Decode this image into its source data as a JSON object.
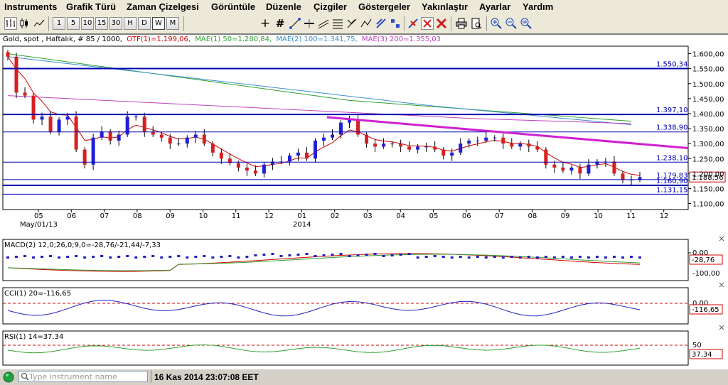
{
  "menu": [
    "Instruments",
    "Grafik Türü",
    "Zaman Çizelgesi",
    "Görüntüle",
    "Düzenle",
    "Çizgiler",
    "Göstergeler",
    "Yakınlaştır",
    "Ayarlar",
    "Yardım"
  ],
  "toolbar": {
    "timeframes": [
      "1",
      "5",
      "10",
      "15",
      "30",
      "H",
      "D",
      "W",
      "M"
    ],
    "active_timeframe": "W",
    "icons": [
      "bar-chart-icon",
      "candle-chart-icon",
      "line-chart-icon",
      "crosshair-icon",
      "grid-hash-icon",
      "draw-line-icon",
      "draw-horizontal-icon",
      "draw-channel-icon",
      "draw-fibo-icon",
      "draw-ray-icon",
      "draw-trend-icon",
      "delete-line-icon",
      "delete-all-icon",
      "print-icon",
      "print-preview-icon",
      "zoom-in-icon",
      "zoom-out-icon",
      "zoom-reset-icon"
    ]
  },
  "chart": {
    "legend": {
      "instrument": "Gold, spot , Haftalık, # 85 / 1000,",
      "otf": "OTF(1)=1.199,06,",
      "mae1": "MAE(1) 50=1.280,84,",
      "mae2": "MAE(2) 100=1.341,75,",
      "mae3": "MAE(3) 200=1.355,03"
    },
    "x_labels": [
      "05",
      "06",
      "07",
      "08",
      "09",
      "10",
      "11",
      "12",
      "01",
      "02",
      "03",
      "04",
      "05",
      "06",
      "07",
      "08",
      "09",
      "10",
      "11",
      "12"
    ],
    "date_label": "May/01/13",
    "year_label": "2014",
    "y_ticks": [
      "1.600,00",
      "1.550,00",
      "1.500,00",
      "1.450,00",
      "1.400,00",
      "1.350,00",
      "1.300,00",
      "1.250,00",
      "1.200,00",
      "1.150,00",
      "1.100,00"
    ],
    "h_lines": [
      "1.550,34",
      "1.397,10",
      "1.338,90",
      "1.238,10",
      "1.179,83",
      "1.160,90",
      "1.131,15"
    ],
    "current_price": "1.188,56",
    "colors": {
      "bull": "#1f1fd8",
      "bear": "#d81f1f",
      "otf": "#d40000",
      "mae1": "#2ea02e",
      "mae2": "#3a8fd0",
      "mae3": "#c040c0",
      "hline": "#0000b0",
      "trend": "#d020d0"
    }
  },
  "chart_data": {
    "type": "candlestick",
    "timeframe": "weekly",
    "ylim": [
      1080,
      1625
    ],
    "x_labels": [
      "05",
      "06",
      "07",
      "08",
      "09",
      "10",
      "11",
      "12",
      "01",
      "02",
      "03",
      "04",
      "05",
      "06",
      "07",
      "08",
      "09",
      "10",
      "11",
      "12"
    ],
    "trendline": [
      1388,
      1285
    ],
    "trendline_label": "",
    "close_approx": [
      1590,
      1470,
      1460,
      1380,
      1390,
      1340,
      1380,
      1390,
      1280,
      1230,
      1320,
      1340,
      1310,
      1330,
      1390,
      1390,
      1340,
      1330,
      1320,
      1300,
      1300,
      1320,
      1330,
      1300,
      1270,
      1250,
      1235,
      1220,
      1210,
      1200,
      1230,
      1240,
      1240,
      1260,
      1270,
      1250,
      1310,
      1320,
      1330,
      1370,
      1380,
      1330,
      1300,
      1290,
      1300,
      1300,
      1290,
      1280,
      1290,
      1290,
      1280,
      1260,
      1270,
      1300,
      1310,
      1310,
      1320,
      1320,
      1300,
      1290,
      1300,
      1290,
      1280,
      1230,
      1220,
      1210,
      1220,
      1200,
      1230,
      1240,
      1240,
      1200,
      1180,
      1180,
      1188
    ]
  },
  "macd": {
    "label": "MACD(2) 12,0;26,0;9,0=-28,76/-21,44/-7,33",
    "ticks": [
      "0,00",
      "-100,00"
    ],
    "value": "-28,76"
  },
  "cci": {
    "label": "CCI(1) 20=-116,65",
    "ticks": [
      "0,00"
    ],
    "value": "-116,65"
  },
  "rsi": {
    "label": "RSI(1) 14=37,34",
    "ticks": [
      "50"
    ],
    "value": "37,34"
  },
  "status": {
    "placeholder": "Type instrument name",
    "time": "16 Kas 2014 23:07:08 EET"
  }
}
